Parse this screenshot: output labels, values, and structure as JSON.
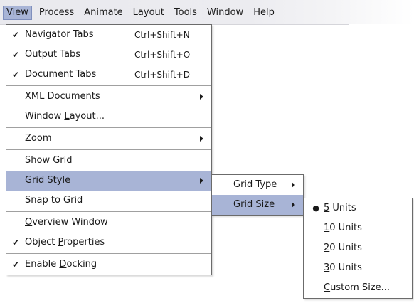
{
  "menubar": {
    "items": [
      {
        "pre": "",
        "acc": "V",
        "post": "iew"
      },
      {
        "pre": "Pro",
        "acc": "c",
        "post": "ess"
      },
      {
        "pre": "",
        "acc": "A",
        "post": "nimate"
      },
      {
        "pre": "",
        "acc": "L",
        "post": "ayout"
      },
      {
        "pre": "",
        "acc": "T",
        "post": "ools"
      },
      {
        "pre": "",
        "acc": "W",
        "post": "indow"
      },
      {
        "pre": "",
        "acc": "H",
        "post": "elp"
      }
    ]
  },
  "view_menu": {
    "items": [
      {
        "check": "✔",
        "pre": "",
        "acc": "N",
        "post": "avigator Tabs",
        "shortcut": "Ctrl+Shift+N"
      },
      {
        "check": "✔",
        "pre": "",
        "acc": "O",
        "post": "utput Tabs",
        "shortcut": "Ctrl+Shift+O"
      },
      {
        "check": "✔",
        "pre": "Documen",
        "acc": "t",
        "post": " Tabs",
        "shortcut": "Ctrl+Shift+D"
      },
      {
        "check": "",
        "pre": "XML ",
        "acc": "D",
        "post": "ocuments",
        "shortcut": ""
      },
      {
        "check": "",
        "pre": "Window ",
        "acc": "L",
        "post": "ayout...",
        "shortcut": ""
      },
      {
        "check": "",
        "pre": "",
        "acc": "Z",
        "post": "oom",
        "shortcut": ""
      },
      {
        "check": "",
        "pre": "Show Grid",
        "acc": "",
        "post": "",
        "shortcut": ""
      },
      {
        "check": "",
        "pre": "",
        "acc": "G",
        "post": "rid Style",
        "shortcut": ""
      },
      {
        "check": "",
        "pre": "Snap to Grid",
        "acc": "",
        "post": "",
        "shortcut": ""
      },
      {
        "check": "",
        "pre": "",
        "acc": "O",
        "post": "verview Window",
        "shortcut": ""
      },
      {
        "check": "✔",
        "pre": "Object ",
        "acc": "P",
        "post": "roperties",
        "shortcut": ""
      },
      {
        "check": "✔",
        "pre": "Enable ",
        "acc": "D",
        "post": "ocking",
        "shortcut": ""
      }
    ]
  },
  "grid_style_menu": {
    "items": [
      {
        "label": "Grid Type"
      },
      {
        "label": "Grid Size"
      }
    ]
  },
  "grid_size_menu": {
    "items": [
      {
        "check": "●",
        "acc": "5",
        "post": " Units"
      },
      {
        "check": "",
        "acc": "1",
        "post": "0 Units"
      },
      {
        "check": "",
        "acc": "2",
        "post": "0 Units"
      },
      {
        "check": "",
        "acc": "3",
        "post": "0 Units"
      },
      {
        "check": "",
        "acc": "C",
        "post": "ustom Size..."
      }
    ]
  },
  "colors": {
    "highlight": "#a8b4d6",
    "menu_border": "#6b6b6b",
    "menubar_bg": "#ececf0"
  }
}
